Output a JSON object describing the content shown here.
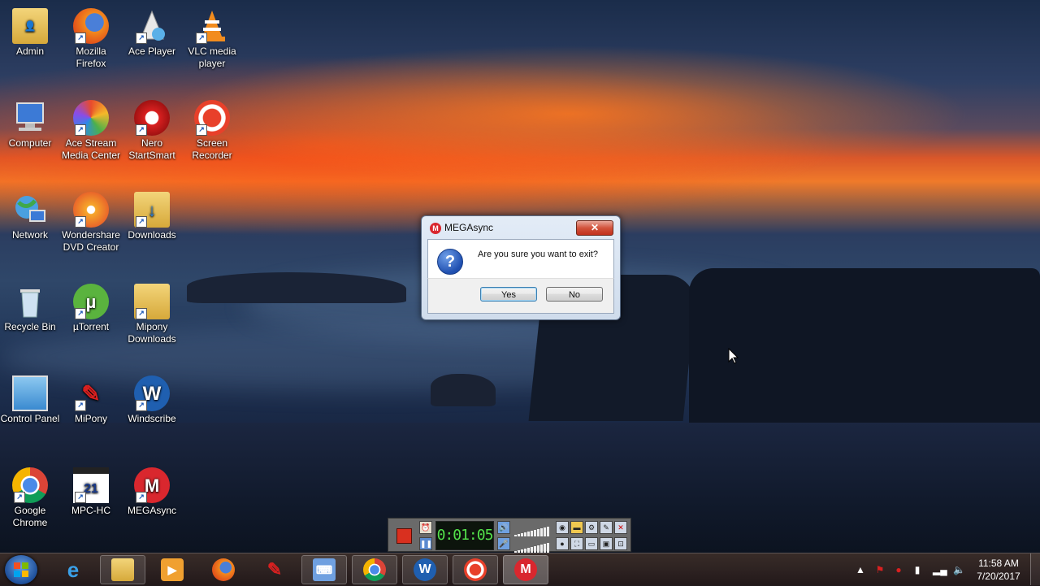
{
  "desktop": {
    "icons": [
      {
        "label": "Admin",
        "icon": "user-folder-icon"
      },
      {
        "label": "Mozilla Firefox",
        "icon": "firefox-icon"
      },
      {
        "label": "Ace Player",
        "icon": "ace-player-icon"
      },
      {
        "label": "VLC media player",
        "icon": "vlc-icon"
      },
      {
        "label": "Computer",
        "icon": "computer-icon"
      },
      {
        "label": "Ace Stream Media Center",
        "icon": "ace-stream-icon"
      },
      {
        "label": "Nero StartSmart",
        "icon": "nero-icon"
      },
      {
        "label": "Screen Recorder",
        "icon": "screen-recorder-icon"
      },
      {
        "label": "Network",
        "icon": "network-icon"
      },
      {
        "label": "Wondershare DVD Creator",
        "icon": "dvd-creator-icon"
      },
      {
        "label": "Downloads",
        "icon": "downloads-folder-icon"
      },
      {
        "label": "Recycle Bin",
        "icon": "recycle-bin-icon"
      },
      {
        "label": "µTorrent",
        "icon": "utorrent-icon"
      },
      {
        "label": "Mipony Downloads",
        "icon": "folder-icon"
      },
      {
        "label": "Control Panel",
        "icon": "control-panel-icon"
      },
      {
        "label": "MiPony",
        "icon": "mipony-icon"
      },
      {
        "label": "Windscribe",
        "icon": "windscribe-icon"
      },
      {
        "label": "Google Chrome",
        "icon": "chrome-icon"
      },
      {
        "label": "MPC-HC",
        "icon": "mpc-hc-icon"
      },
      {
        "label": "MEGAsync",
        "icon": "megasync-icon"
      }
    ]
  },
  "dialog": {
    "title": "MEGAsync",
    "close_label": "✕",
    "message": "Are you sure you want to exit?",
    "yes_label": "Yes",
    "no_label": "No"
  },
  "recorder": {
    "timer": "0:01:05"
  },
  "taskbar": {
    "clock_time": "11:58 AM",
    "clock_date": "7/20/2017"
  },
  "colors": {
    "mega_red": "#d9272e",
    "dialog_blue": "#1f4fb0",
    "timer_green": "#53e04a"
  }
}
